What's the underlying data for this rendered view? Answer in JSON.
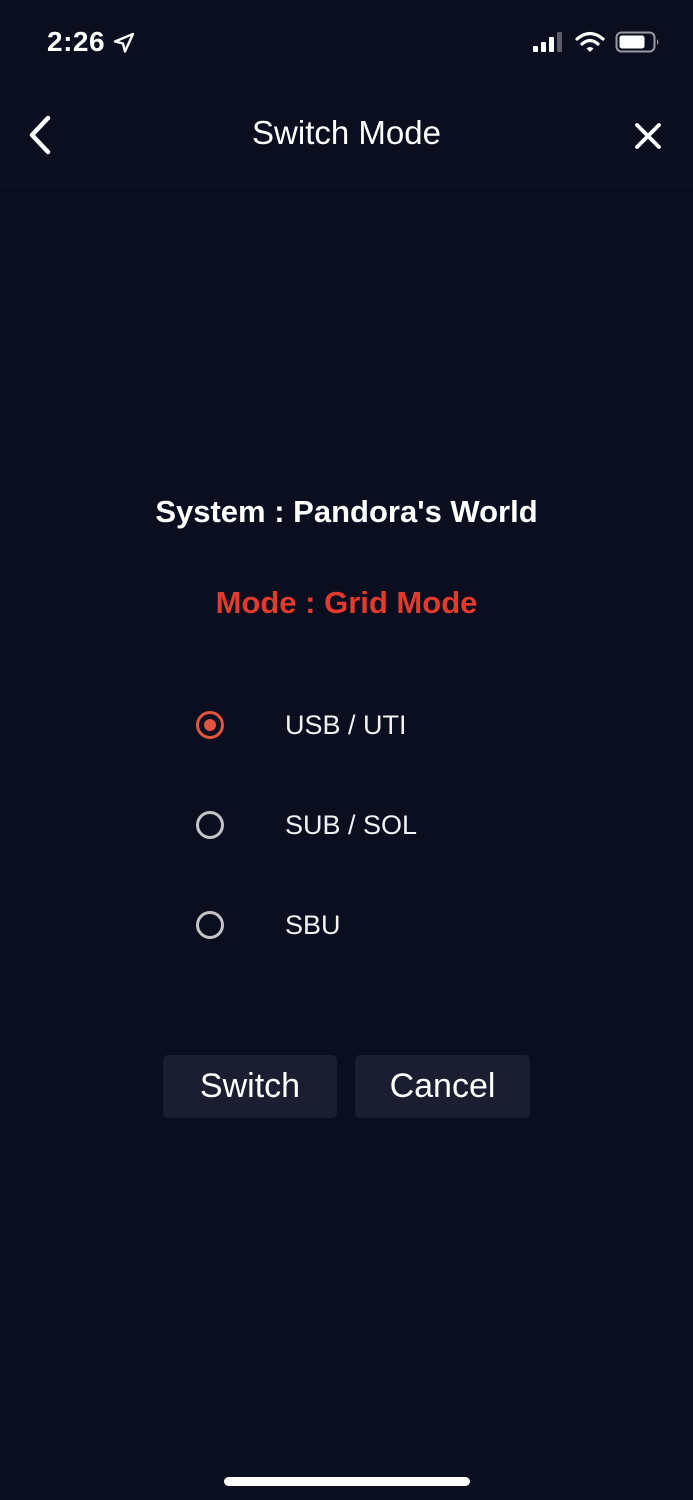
{
  "status_bar": {
    "time": "2:26",
    "icons": [
      "location-arrow-icon",
      "cellular-signal-icon",
      "wifi-icon",
      "battery-icon"
    ]
  },
  "nav": {
    "title": "Switch Mode",
    "back_icon": "chevron-left-icon",
    "close_icon": "close-icon"
  },
  "info": {
    "system_line": "System : Pandora's World",
    "mode_line": "Mode : Grid Mode",
    "mode_color": "#e33a2e"
  },
  "options": [
    {
      "label": "USB / UTI",
      "selected": true
    },
    {
      "label": "SUB / SOL",
      "selected": false
    },
    {
      "label": "SBU",
      "selected": false
    }
  ],
  "actions": {
    "switch_label": "Switch",
    "cancel_label": "Cancel"
  },
  "colors": {
    "background": "#0b0e1e",
    "accent": "#e0553f",
    "button_bg": "#1b1e31"
  }
}
